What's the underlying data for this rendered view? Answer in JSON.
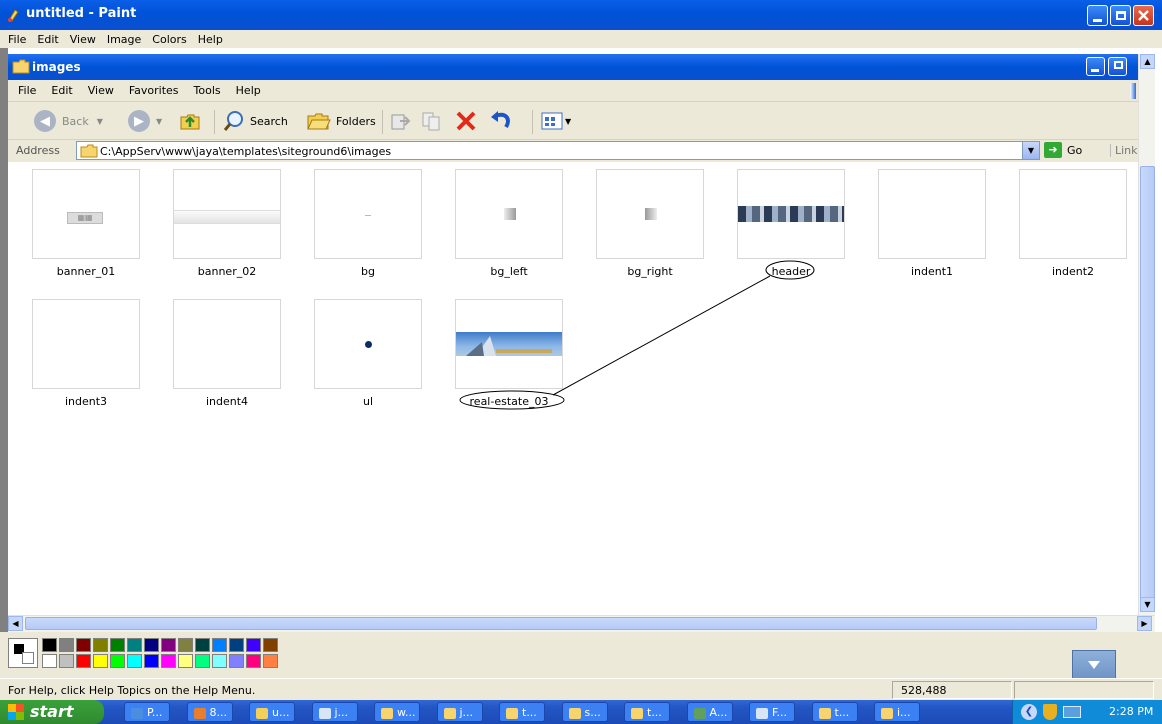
{
  "paint": {
    "title": "untitled - Paint",
    "menu": [
      "File",
      "Edit",
      "View",
      "Image",
      "Colors",
      "Help"
    ],
    "status_help": "For Help, click Help Topics on the Help Menu.",
    "coords": "528,488"
  },
  "explorer": {
    "title": "images",
    "menu": [
      "File",
      "Edit",
      "View",
      "Favorites",
      "Tools",
      "Help"
    ],
    "toolbar": {
      "back": "Back",
      "search": "Search",
      "folders": "Folders"
    },
    "address": {
      "label": "Address",
      "path": "C:\\AppServ\\www\\jaya\\templates\\siteground6\\images",
      "go": "Go",
      "links": "Links"
    },
    "files": [
      {
        "name": "banner_01",
        "annotated": false
      },
      {
        "name": "banner_02",
        "annotated": false
      },
      {
        "name": "bg",
        "annotated": false
      },
      {
        "name": "bg_left",
        "annotated": false
      },
      {
        "name": "bg_right",
        "annotated": false
      },
      {
        "name": "header",
        "annotated": true
      },
      {
        "name": "indent1",
        "annotated": false
      },
      {
        "name": "indent2",
        "annotated": false
      },
      {
        "name": "indent3",
        "annotated": false
      },
      {
        "name": "indent4",
        "annotated": false
      },
      {
        "name": "ul",
        "annotated": false
      },
      {
        "name": "real-estate_03",
        "annotated": true
      }
    ]
  },
  "palette": {
    "row1": [
      "#000000",
      "#808080",
      "#800000",
      "#808000",
      "#008000",
      "#008080",
      "#000080",
      "#800080",
      "#808040",
      "#004040",
      "#0080ff",
      "#004080",
      "#4000ff",
      "#804000"
    ],
    "row2": [
      "#ffffff",
      "#c0c0c0",
      "#ff0000",
      "#ffff00",
      "#00ff00",
      "#00ffff",
      "#0000ff",
      "#ff00ff",
      "#ffff80",
      "#00ff80",
      "#80ffff",
      "#8080ff",
      "#ff0080",
      "#ff8040"
    ]
  },
  "taskbar": {
    "start": "start",
    "tasks": [
      "P...",
      "8...",
      "u...",
      "j...",
      "w...",
      "j...",
      "t...",
      "s...",
      "t...",
      "A...",
      "F...",
      "t...",
      "i..."
    ],
    "clock": "2:28 PM"
  },
  "colors": {
    "titlebar": "#0a5ee8",
    "taskbar": "#2456c4",
    "start": "#3aa13a",
    "chrome": "#ece9d8"
  }
}
